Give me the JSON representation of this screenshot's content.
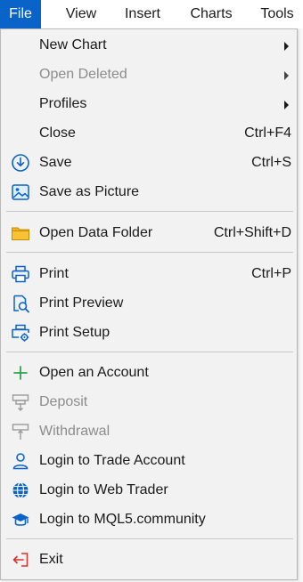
{
  "menubar": {
    "items": [
      {
        "label": "File",
        "active": true
      },
      {
        "label": "View"
      },
      {
        "label": "Insert"
      },
      {
        "label": "Charts"
      },
      {
        "label": "Tools"
      }
    ]
  },
  "colors": {
    "accent": "#0a63c9",
    "menu_bg": "#f2f2f2",
    "disabled_text": "#8c8c8c",
    "open_account_green": "#2ea44f",
    "exit_red": "#d9342b",
    "folder_yellow": "#f2b21b"
  },
  "file_menu": {
    "items": [
      {
        "label": "New Chart",
        "submenu": true,
        "icon": ""
      },
      {
        "label": "Open Deleted",
        "submenu": true,
        "disabled": true,
        "icon": ""
      },
      {
        "label": "Profiles",
        "submenu": true,
        "icon": ""
      },
      {
        "label": "Close",
        "shortcut": "Ctrl+F4",
        "icon": ""
      },
      {
        "label": "Save",
        "shortcut": "Ctrl+S",
        "icon": "save-icon"
      },
      {
        "label": "Save as Picture",
        "icon": "picture-icon"
      },
      {
        "label": "Open Data Folder",
        "shortcut": "Ctrl+Shift+D",
        "icon": "folder-icon"
      },
      {
        "label": "Print",
        "shortcut": "Ctrl+P",
        "icon": "printer-icon"
      },
      {
        "label": "Print Preview",
        "icon": "print-preview-icon"
      },
      {
        "label": "Print Setup",
        "icon": "print-setup-icon"
      },
      {
        "label": "Open an Account",
        "icon": "plus-icon"
      },
      {
        "label": "Deposit",
        "disabled": true,
        "icon": "deposit-icon"
      },
      {
        "label": "Withdrawal",
        "disabled": true,
        "icon": "withdrawal-icon"
      },
      {
        "label": "Login to Trade Account",
        "icon": "user-icon"
      },
      {
        "label": "Login to Web Trader",
        "icon": "globe-icon"
      },
      {
        "label": "Login to MQL5.community",
        "icon": "graduation-cap-icon"
      },
      {
        "label": "Exit",
        "icon": "exit-icon"
      }
    ]
  }
}
